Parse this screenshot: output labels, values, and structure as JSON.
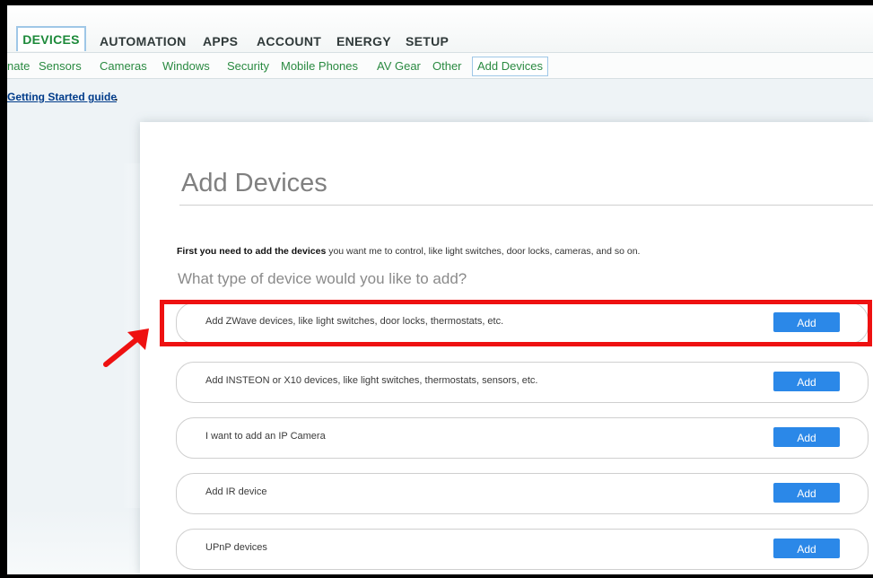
{
  "top_tabs": {
    "devices": "DEVICES",
    "automation": "AUTOMATION",
    "apps": "APPS",
    "account": "ACCOUNT",
    "energy": "ENERGY",
    "setup": "SETUP"
  },
  "subnav": {
    "climate_partial": "nate",
    "sensors": "Sensors",
    "cameras": "Cameras",
    "windows": "Windows",
    "security": "Security",
    "mobile_phones": "Mobile Phones",
    "av_gear": "AV Gear",
    "other": "Other",
    "add_devices": "Add Devices"
  },
  "guide_link": "Getting Started guide",
  "guide_punct": ".",
  "main": {
    "title": "Add Devices",
    "intro_bold": "First you need to add the devices",
    "intro_rest": " you want me to control, like light switches, door locks, cameras, and so on.",
    "question": "What type of device would you like to add?",
    "options": [
      {
        "label": "Add ZWave devices, like light switches, door locks, thermostats, etc.",
        "button": "Add"
      },
      {
        "label": "Add INSTEON or X10 devices, like light switches, thermostats, sensors, etc.",
        "button": "Add"
      },
      {
        "label": "I want to add an IP Camera",
        "button": "Add"
      },
      {
        "label": "Add IR device",
        "button": "Add"
      },
      {
        "label": "UPnP devices",
        "button": "Add"
      }
    ]
  },
  "colors": {
    "accent_green": "#1d8a3a",
    "button_blue": "#2b88e8",
    "highlight_red": "#ee1111"
  }
}
